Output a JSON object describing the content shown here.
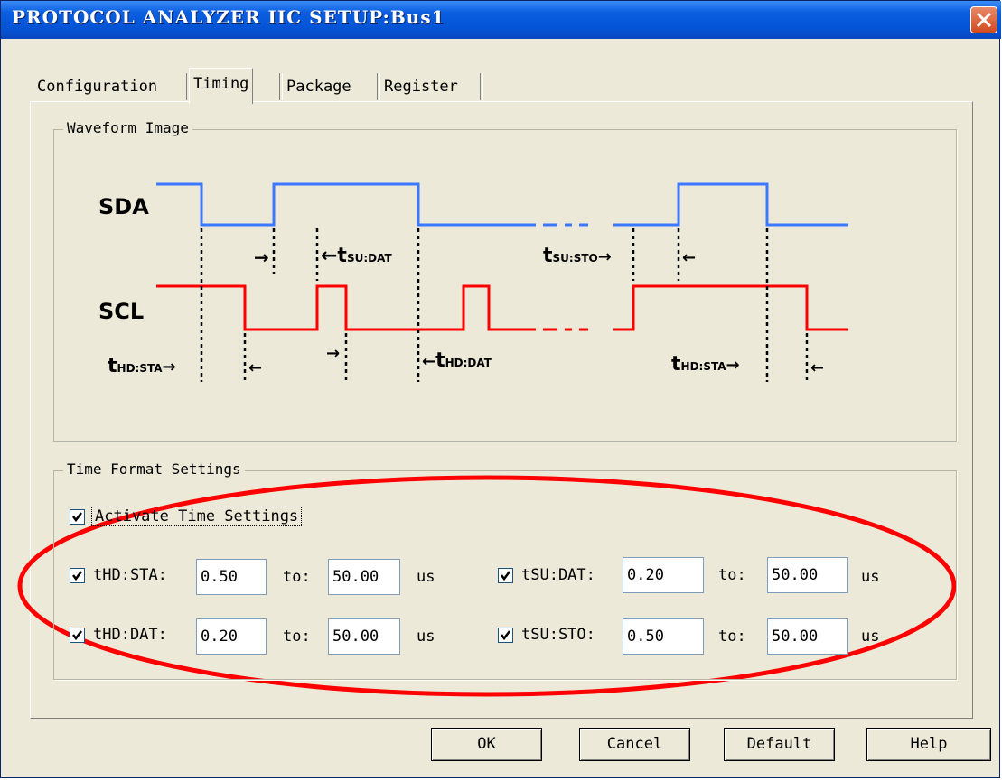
{
  "window": {
    "title": "PROTOCOL ANALYZER IIC SETUP:Bus1",
    "close_label": "×"
  },
  "tabs": [
    {
      "label": "Configuration",
      "selected": false
    },
    {
      "label": "Timing",
      "selected": true
    },
    {
      "label": "Package",
      "selected": false
    },
    {
      "label": "Register",
      "selected": false
    }
  ],
  "waveform": {
    "group_label": "Waveform Image",
    "sda_label": "SDA",
    "scl_label": "SCL",
    "sda_color": "#3b78ff",
    "scl_color": "#ff0000",
    "annotations": {
      "left_arrow_1": "→",
      "t_su_dat": "←t",
      "t_su_dat_sub": "SU:DAT",
      "t_su_sto": "t",
      "t_su_sto_sub": "SU:STO",
      "t_su_sto_arrow": "→",
      "right_arrow_1": "←",
      "t_hd_sta_1": "t",
      "t_hd_sta_1_sub": "HD:STA",
      "t_hd_sta_1_arrow": "→",
      "arrow_after_sta": "←",
      "arrow_before_dat": "→",
      "t_hd_dat_arrow": "←",
      "t_hd_dat": "t",
      "t_hd_dat_sub": "HD:DAT",
      "t_hd_sta_2": "t",
      "t_hd_sta_2_sub": "HD:STA",
      "t_hd_sta_2_arrow": "→",
      "final_arrow": "←"
    }
  },
  "time_format": {
    "group_label": "Time Format Settings",
    "activate_label": "Activate Time Settings",
    "activate_checked": true,
    "to_label": "to:",
    "unit": "us",
    "rows": [
      {
        "label": "tHD:STA:",
        "checked": true,
        "min": "0.50",
        "max": "50.00"
      },
      {
        "label": "tHD:DAT:",
        "checked": true,
        "min": "0.20",
        "max": "50.00"
      },
      {
        "label": "tSU:DAT:",
        "checked": true,
        "min": "0.20",
        "max": "50.00"
      },
      {
        "label": "tSU:STO:",
        "checked": true,
        "min": "0.50",
        "max": "50.00"
      }
    ]
  },
  "highlight_color": "#ff0000",
  "buttons": {
    "ok": "OK",
    "cancel": "Cancel",
    "default": "Default",
    "help": "Help"
  }
}
